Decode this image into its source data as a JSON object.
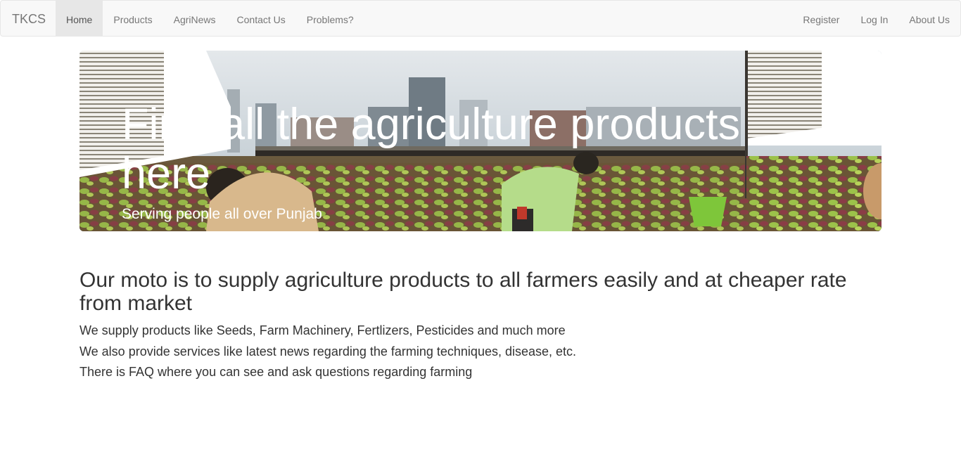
{
  "navbar": {
    "brand": "TKCS",
    "left_items": [
      "Home",
      "Products",
      "AgriNews",
      "Contact Us",
      "Problems?"
    ],
    "active": "Home",
    "right_items": [
      "Register",
      "Log In",
      "About Us"
    ]
  },
  "hero": {
    "title": "Find all the agriculture products here",
    "subtitle": "Serving people all over Punjab"
  },
  "content": {
    "heading": "Our moto is to supply agriculture products to all farmers easily and at cheaper rate from market",
    "lines": [
      "We supply products like Seeds, Farm Machinery, Fertlizers, Pesticides and much more",
      "We also provide services like latest news regarding the farming techniques, disease, etc.",
      "There is FAQ where you can see and ask questions regarding farming"
    ]
  },
  "colors": {
    "navbar_bg": "#f8f8f8",
    "nav_text": "#777777",
    "nav_active_bg": "#e7e7e7",
    "body_text": "#333333",
    "hero_text": "#ffffff"
  }
}
